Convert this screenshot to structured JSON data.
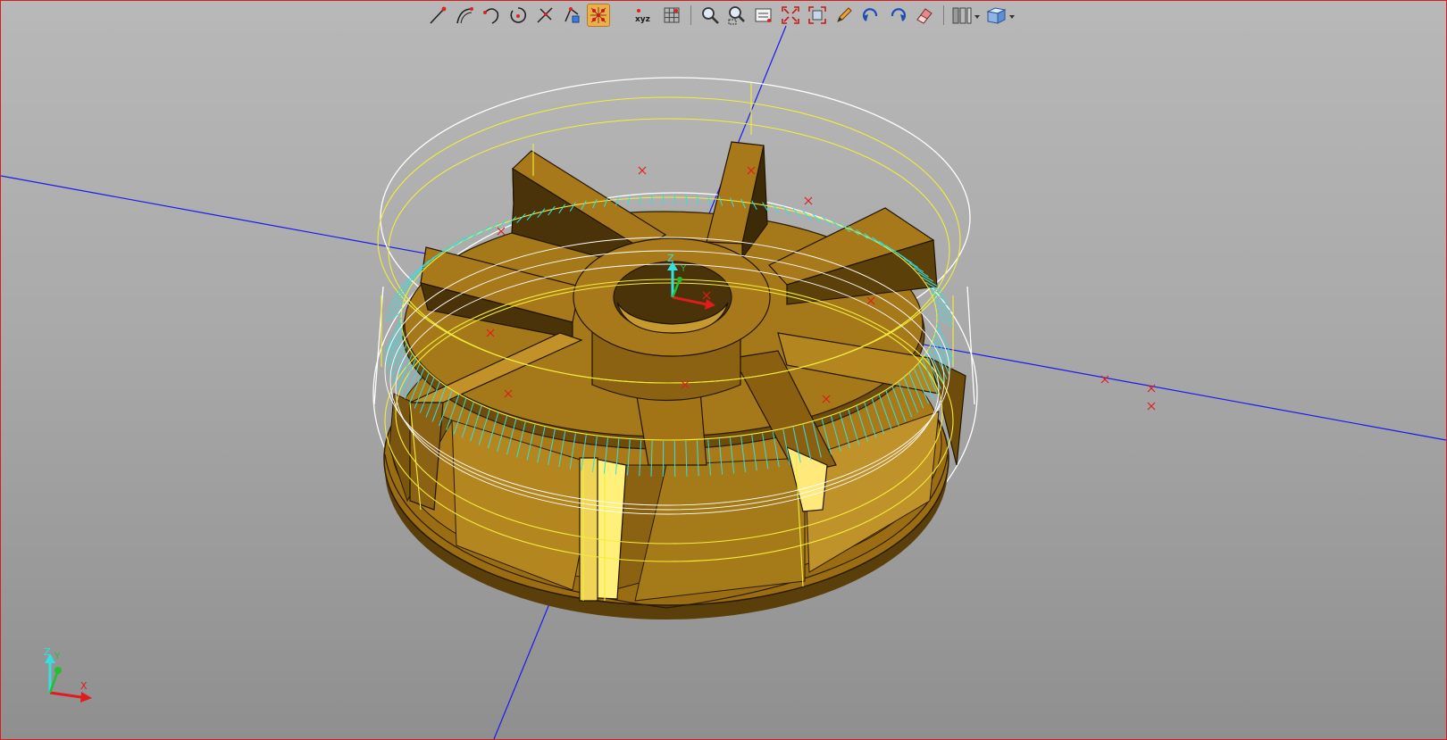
{
  "toolbar": {
    "xyz_label": "xyz",
    "tools": [
      "line-tool-icon",
      "arc-tool-icon",
      "three-point-arc-icon",
      "circle-tool-icon",
      "trim-tool-icon",
      "transform-tool-icon",
      "snap-grid-icon",
      "point-xyz-icon",
      "grid-icon",
      "zoom-icon",
      "zoom-window-icon",
      "view-list-icon",
      "fit-all-icon",
      "zoom-extents-icon",
      "pencil-icon",
      "undo-icon",
      "redo-icon",
      "eraser-icon",
      "toolpath-display-icon",
      "view-cube-icon"
    ]
  },
  "axes": {
    "z": "Z",
    "y": "Y",
    "x": "X"
  },
  "colors": {
    "part": "#a97a17",
    "part_dark": "#5a3f0a",
    "part_light": "#d2a431",
    "wire_yellow": "#f2ee3b",
    "wire_cyan": "#32e0e0",
    "axis_blue": "#1a1af0",
    "marker_red": "#e01c1c"
  }
}
